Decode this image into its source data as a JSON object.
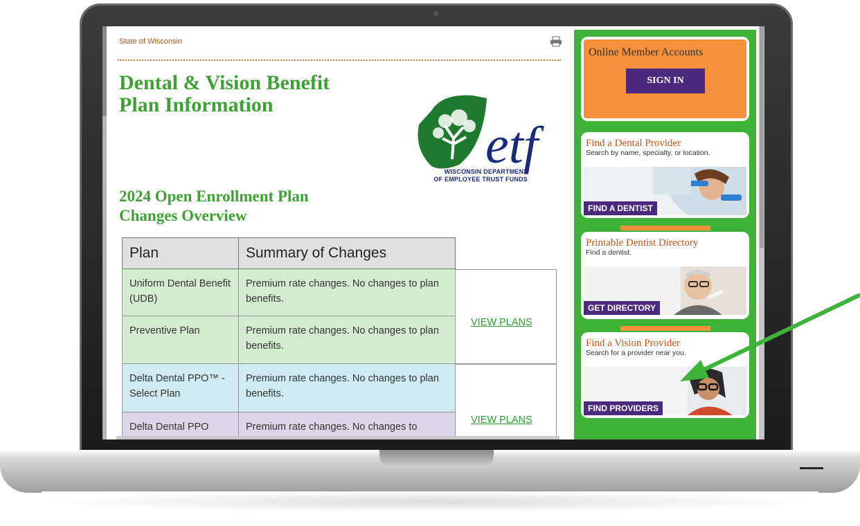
{
  "header": {
    "state_link": "State of Wisconsin",
    "page_title": "Dental & Vision Benefit Plan Information",
    "logo_text_line1": "WISCONSIN DEPARTMENT",
    "logo_text_line2": "OF EMPLOYEE TRUST FUNDS",
    "logo_wordmark": "etf"
  },
  "overview": {
    "title": "2024 Open Enrollment Plan Changes Overview",
    "columns": [
      "Plan",
      "Summary of Changes"
    ],
    "rows": [
      {
        "plan": "Uniform Dental Benefit (UDB)",
        "summary": "Premium rate changes. No changes to plan benefits."
      },
      {
        "plan": "Preventive Plan",
        "summary": "Premium rate changes. No changes to plan benefits."
      },
      {
        "plan": "Delta Dental PPO™ - Select Plan",
        "summary": "Premium rate changes. No changes to plan benefits."
      },
      {
        "plan": "Delta Dental PPO",
        "summary": "Premium rate changes. No changes to"
      }
    ],
    "view_plans": "VIEW PLANS"
  },
  "sidebar": {
    "account": {
      "title": "Online Member Accounts",
      "button": "SIGN IN"
    },
    "cards": [
      {
        "title": "Find a Dental Provider",
        "subtitle": "Search by name, specialty, or location.",
        "cta": "FIND A DENTIST"
      },
      {
        "title": "Printable Dentist Directory",
        "subtitle": "Find a dentist.",
        "cta": "GET DIRECTORY"
      },
      {
        "title": "Find a Vision Provider",
        "subtitle": "Search for a provider near you.",
        "cta": "FIND PROVIDERS"
      }
    ]
  },
  "colors": {
    "brand_green": "#3da133",
    "sidebar_green": "#3fb23a",
    "accent_orange": "#f5903b",
    "button_purple": "#4a2a7d"
  }
}
